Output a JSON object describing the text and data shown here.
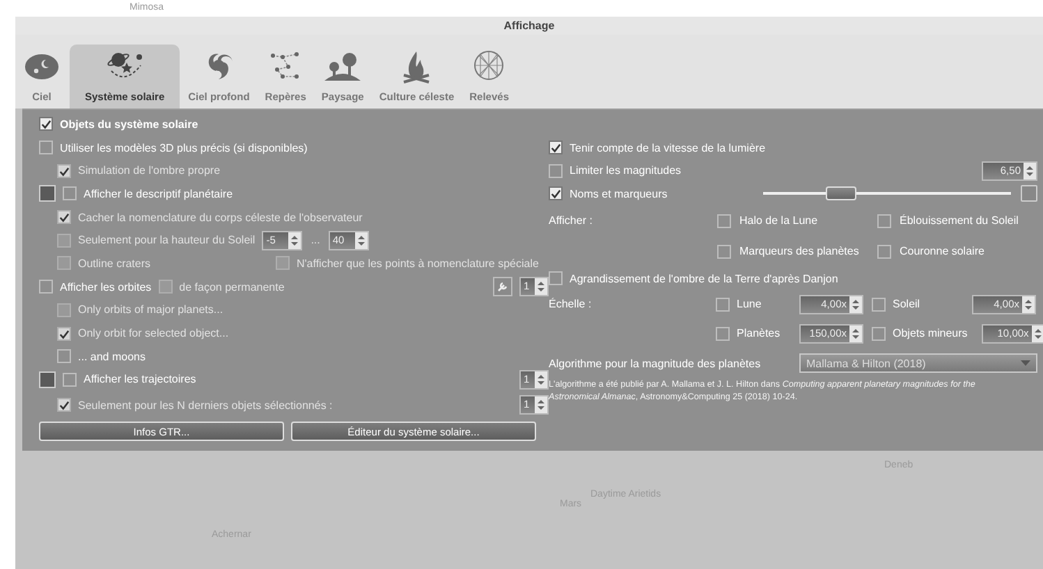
{
  "window": {
    "title": "Affichage"
  },
  "tabs": [
    {
      "label": "Ciel",
      "selected": false
    },
    {
      "label": "Système solaire",
      "selected": true
    },
    {
      "label": "Ciel profond",
      "selected": false
    },
    {
      "label": "Repères",
      "selected": false
    },
    {
      "label": "Paysage",
      "selected": false
    },
    {
      "label": "Culture céleste",
      "selected": false
    },
    {
      "label": "Relevés",
      "selected": false
    }
  ],
  "main_toggle": {
    "label": "Objets du système solaire",
    "checked": true
  },
  "left_options": [
    {
      "kind": "check",
      "label": "Utiliser les modèles 3D plus précis (si disponibles)",
      "checked": false,
      "disabled": false,
      "children": [
        {
          "kind": "check",
          "label": "Simulation de l'ombre propre",
          "checked": true,
          "disabled": true
        }
      ]
    },
    {
      "kind": "check",
      "color": "#5a5a5a",
      "label": "Afficher le descriptif planétaire",
      "checked": false,
      "disabled": false,
      "children": [
        {
          "kind": "check",
          "label": "Cacher la nomenclature du corps céleste de l'observateur",
          "checked": true,
          "disabled": true
        },
        {
          "kind": "range",
          "label": "Seulement pour la hauteur du Soleil",
          "checked": false,
          "disabled": true,
          "from": "-5",
          "separator": "...",
          "to": "40"
        },
        {
          "kind": "pair",
          "label": "Outline craters",
          "checked": false,
          "disabled": true,
          "second": {
            "label": "N'afficher que les points à nomenclature spéciale",
            "checked": false,
            "disabled": true
          }
        }
      ]
    },
    {
      "kind": "check",
      "label": "Afficher les orbites",
      "checked": false,
      "disabled": false,
      "extra": {
        "label": "de façon permanente",
        "checked": false,
        "disabled": true
      },
      "tool_button": true,
      "spin": "1",
      "children": [
        {
          "kind": "check",
          "label": "Only orbits of major planets...",
          "checked": false,
          "disabled": true
        },
        {
          "kind": "check",
          "label": "Only orbit for selected object...",
          "checked": true,
          "disabled": true
        },
        {
          "kind": "check",
          "label": "... and moons",
          "checked": false,
          "disabled": false
        }
      ]
    },
    {
      "kind": "check",
      "color": "#5a5a5a",
      "label": "Afficher les trajectoires",
      "checked": false,
      "disabled": false,
      "spin": "1",
      "children": [
        {
          "kind": "check",
          "label": "Seulement pour les N derniers objets sélectionnés :",
          "checked": true,
          "disabled": true,
          "spin": "1"
        }
      ]
    }
  ],
  "buttons": [
    "Infos GTR...",
    "Éditeur du système solaire..."
  ],
  "right_options": [
    {
      "kind": "check",
      "label": "Tenir compte de la vitesse de la lumière",
      "checked": true
    },
    {
      "kind": "check",
      "label": "Limiter les magnitudes",
      "checked": false,
      "spin": "6,50"
    },
    {
      "kind": "slider",
      "label": "Noms et marqueurs",
      "checked": true,
      "level": 0.31
    }
  ],
  "display": {
    "label": "Afficher :",
    "options": [
      {
        "label": "Halo de la Lune",
        "checked": false
      },
      {
        "label": "Éblouissement du Soleil",
        "checked": false
      },
      {
        "label": "Marqueurs des planètes",
        "checked": false
      },
      {
        "label": "Couronne solaire",
        "checked": false
      }
    ]
  },
  "danjon": {
    "label": "Agrandissement de l'ombre de la Terre d'après Danjon",
    "checked": false
  },
  "scale": {
    "label": "Échelle :",
    "items": [
      {
        "label": "Lune",
        "checked": false,
        "value": "4,00x"
      },
      {
        "label": "Soleil",
        "checked": false,
        "value": "4,00x"
      },
      {
        "label": "Planètes",
        "checked": false,
        "value": "150,00x"
      },
      {
        "label": "Objets mineurs",
        "checked": false,
        "value": "10,00x"
      }
    ]
  },
  "algorithm": {
    "label": "Algorithme pour la magnitude des planètes",
    "value": "Mallama & Hilton (2018)"
  },
  "note": "L'algorithme a été publié par A. Mallama et J. L. Hilton dans *Computing apparent planetary magnitudes for the Astronomical Almanac*, Astronomy&Computing 25 (2018) 10-24.",
  "sky_labels": [
    {
      "text": "Mimosa"
    },
    {
      "text": "Deneb"
    },
    {
      "text": "Mars"
    },
    {
      "text": "Daytime Arietids"
    },
    {
      "text": "Achernar"
    }
  ]
}
